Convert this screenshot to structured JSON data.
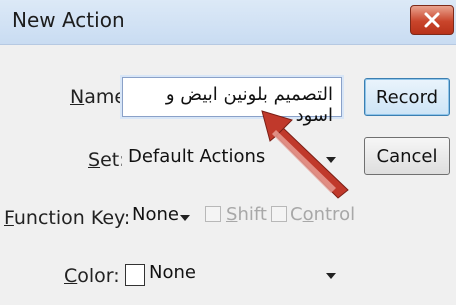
{
  "window": {
    "title": "New Action",
    "close_icon": "close-icon"
  },
  "form": {
    "name": {
      "label_accel": "N",
      "label_rest": "ame:",
      "value": "التصميم بلونين ابيض و اسود"
    },
    "set": {
      "label_accel": "S",
      "label_rest": "et:",
      "value": "Default Actions"
    },
    "function_key": {
      "label_accel": "F",
      "label_rest": "unction Key:",
      "value": "None",
      "shift": {
        "label_accel": "S",
        "label_rest": "hift",
        "checked": false
      },
      "control": {
        "label_pre": "C",
        "label_accel": "o",
        "label_rest": "ntrol",
        "checked": false
      }
    },
    "color": {
      "label_accel": "C",
      "label_rest": "olor:",
      "value": "None",
      "swatch_color": "#ffffff"
    }
  },
  "buttons": {
    "record": "Record",
    "cancel": "Cancel"
  },
  "annotation": {
    "arrow_color": "#c0392b",
    "arrow_icon": "pointer-arrow"
  }
}
